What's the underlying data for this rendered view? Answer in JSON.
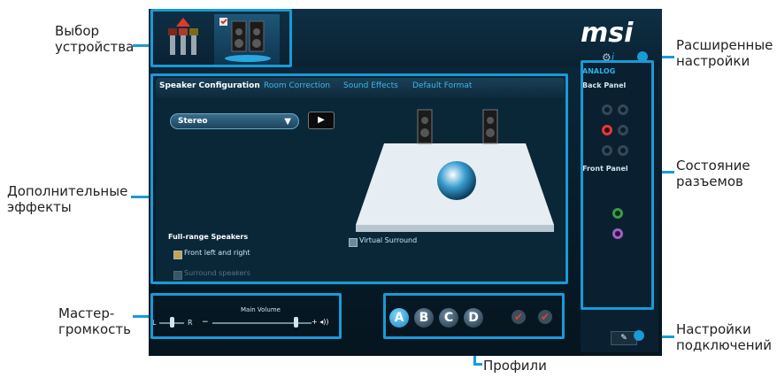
{
  "annotations": {
    "device_select": "Выбор устройства",
    "advanced_settings": "Расширенные настройки",
    "additional_effects": "Дополнительные эффекты",
    "jack_status": "Состояние разъемов",
    "master_volume": "Мастер-громкость",
    "connection_settings": "Настройки подключений",
    "profiles": "Профили"
  },
  "app": {
    "logo": "msi",
    "tabs": [
      "Speaker Configuration",
      "Room Correction",
      "Sound Effects",
      "Default Format"
    ],
    "config_select": "Stereo",
    "full_range_title": "Full-range Speakers",
    "front_left_right": "Front left and right",
    "surround_speakers": "Surround speakers",
    "virtual_surround": "Virtual Surround",
    "analog_label": "ANALOG",
    "back_panel": "Back Panel",
    "front_panel": "Front Panel",
    "main_volume": "Main Volume",
    "vol_left": "L",
    "vol_right": "R",
    "vol_minus": "−",
    "vol_plus": "+ ◂))",
    "profiles": [
      "A",
      "B",
      "C",
      "D"
    ]
  },
  "colors": {
    "accent": "#1a9ad6",
    "app_bg": "#0b2b3f",
    "link": "#3fb7ea"
  }
}
